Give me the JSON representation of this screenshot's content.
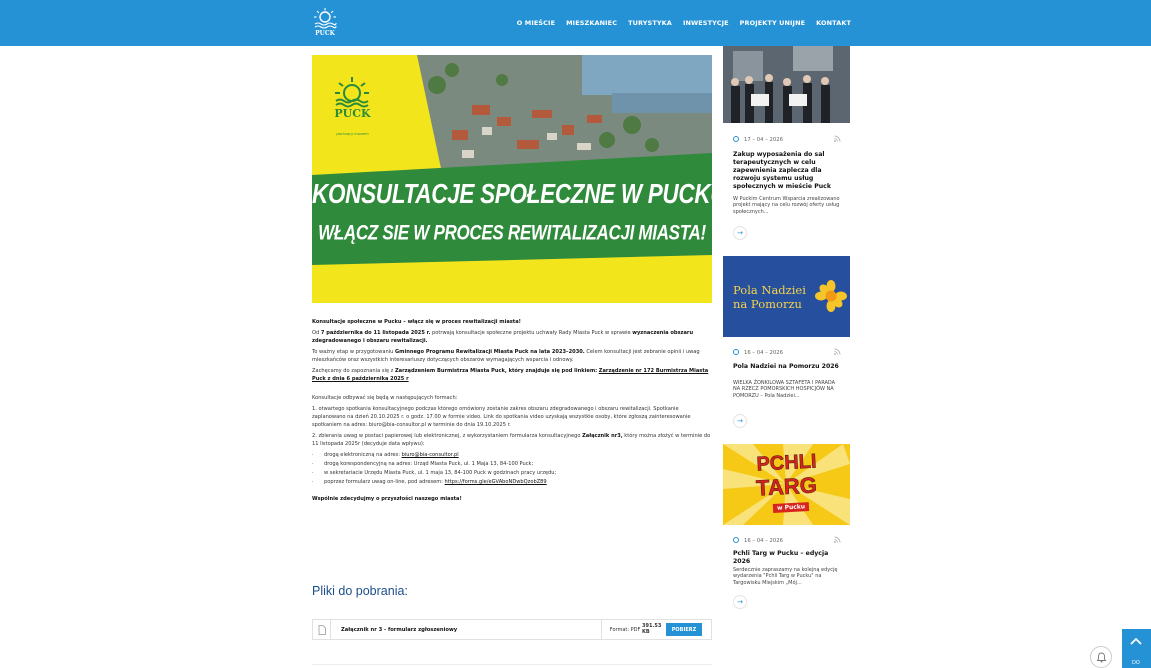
{
  "brand": {
    "logo_text": "PUCK"
  },
  "nav": {
    "items": [
      "O MIEŚCIE",
      "MIESZKANIEC",
      "TURYSTYKA",
      "INWESTYCJE",
      "PROJEKTY UNIJNE",
      "KONTAKT"
    ]
  },
  "hero": {
    "brand": "PUCK",
    "brand_sub": "pachnący morzem",
    "line1": "KONSULTACJE SPOŁECZNE W PUCKU",
    "line2": "WŁĄCZ SIE W PROCES REWITALIZACJI MIASTA!"
  },
  "article": {
    "lead": "Konsultacje społeczne w Pucku – włącz się w proces rewitalizacji miasta!",
    "p1_a": "Od ",
    "p1_b": "7 października do 11 listopada 2025 r.",
    "p1_c": " potrwają konsultacje społeczne projektu uchwały Rady Miasta Puck w sprawie ",
    "p1_d": "wyznaczenia obszaru zdegradowanego i obszaru rewitalizacji.",
    "p2_a": "To ważny etap w przygotowaniu ",
    "p2_b": "Gminnego Programu Rewitalizacji Miasta Puck na lata 2023–2030.",
    "p2_c": " Celem konsultacji jest zebranie opinii i uwag mieszkańców oraz wszystkich interesariuszy dotyczących obszarów wymagających wsparcia i odnowy.",
    "p3_a": "Zachęcamy do zapoznania się z ",
    "p3_b": "Zarządzeniem Burmistrza Miasta Puck, który znajduje się pod linkiem:",
    "p3_link": "Zarządzenie nr 172 Burmistrza Miasta Puck z dnia 6 października 2025 r",
    "p4": "Konsultacje odbywać się będą w następujących formach:",
    "p5": "1.     otwartego spotkania konsultacyjnego podczas którego omówiony zostanie zakres obszaru zdegradowanego i obszaru rewitalizacji. Spotkanie zaplanowano na dzień 20.10.2025 r. o godz. 17.00 w formie video. Link do spotkania video uzyskają wszystkie osoby, które zgłoszą zainteresowanie spotkaniem na adres: biuro@bia-consultor.pl w terminie do dnia 19.10.2025 r.",
    "p6_a": "2.     zbierania uwag w postaci papierowej lub elektronicznej, z wykorzystaniem formularza konsultacyjnego ",
    "p6_b": "Załącznik nr3,",
    "p6_c": " który można złożyć w terminie do 11 listopada 2025r (decyduje data wpływu):",
    "b1_a": "drogą elektroniczną na adres: ",
    "b1_link": "biuro@bia-consultor.pl",
    "b2": "drogą korespondencyjną na adres: Urząd Miasta Puck, ul. 1 Maja 13, 84-100 Puck;",
    "b3": "w sekretariacie Urzędu Miasta Puck, ul. 1 maja 13, 84-100 Puck w godzinach pracy urzędu;",
    "b4_a": "poprzez formularz uwag on-line, pod adresem: ",
    "b4_link": "https://forms.gle/eGVAboNDwbQzobZ89",
    "bullet": "·",
    "closing": "Wspólnie zdecydujmy o przyszłości naszego miasta!"
  },
  "downloads": {
    "title": "Pliki do pobrania:",
    "file_name": "Załącznik nr 3 - formularz zgłoszeniowy",
    "format_label": "Format: PDF",
    "size": "391.53 KB",
    "button": "POBIERZ"
  },
  "sidebar": {
    "posts": [
      {
        "date": "17 – 04 – 2026",
        "title": "Zakup wyposażenia do sal terapeutycznych w celu zapewnienia zaplecza dla rozwoju systemu usług społecznych w mieście Puck",
        "desc": "W Puckim Centrum Wsparcia zrealizowano projekt mający na celu rozwój oferty usług społecznych..."
      },
      {
        "date": "16 – 04 – 2026",
        "image_line1": "Pola Nadziei",
        "image_line2": "na Pomorzu",
        "title": "Pola Nadziei na Pomorzu 2026",
        "desc": "WIELKA ŻONKILOWA SZTAFETA I PARADA NA RZECZ POMORSKICH HOSPICJÓW NA POMORZU – Pola Nadziei..."
      },
      {
        "date": "16 – 04 – 2026",
        "image_line1": "PCHLI",
        "image_line2": "TARG",
        "image_line3": "w Pucku",
        "title": "Pchli Targ w Pucku – edycja 2026",
        "desc": "Serdecznie zapraszamy na kolejną edycję wydarzenia \"Pchli Targ w Pucku\" na Targowisku Miejskim „Mój..."
      }
    ],
    "arrow": "→"
  },
  "widgets": {
    "to_top_label": "DO"
  },
  "colors": {
    "primary": "#2592d5",
    "hero_yellow": "#f2e51c",
    "hero_green": "#2a8a3a"
  }
}
